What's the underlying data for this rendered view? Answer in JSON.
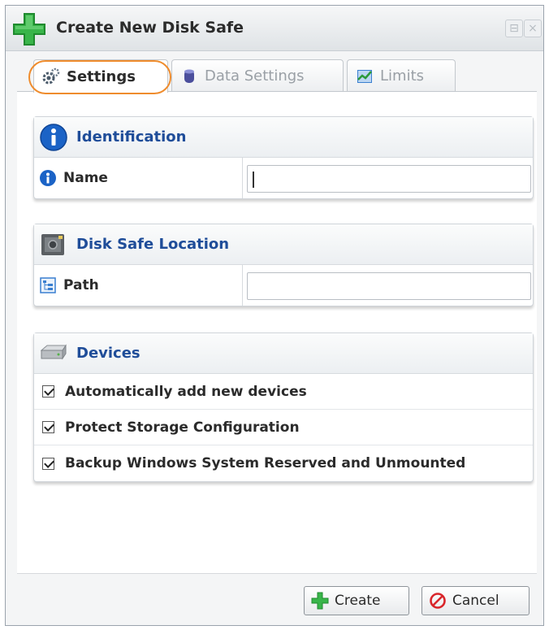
{
  "window": {
    "title": "Create New Disk Safe",
    "max_symbol": "⊟",
    "close_symbol": "×",
    "title_icon": "green-plus-icon"
  },
  "tabs": [
    {
      "label": "Settings",
      "icon": "gears-icon",
      "active": true
    },
    {
      "label": "Data Settings",
      "icon": "database-icon",
      "active": false
    },
    {
      "label": "Limits",
      "icon": "chart-icon",
      "active": false
    }
  ],
  "identification": {
    "title": "Identification",
    "icon": "info-icon",
    "name_label": "Name",
    "name_value": ""
  },
  "location": {
    "title": "Disk Safe Location",
    "icon": "safe-icon",
    "path_label": "Path",
    "path_value": ""
  },
  "devices": {
    "title": "Devices",
    "icon": "disk-drive-icon",
    "options": [
      {
        "label": "Automatically add new devices",
        "checked": true
      },
      {
        "label": "Protect Storage Configuration",
        "checked": true
      },
      {
        "label": "Backup Windows System Reserved and Unmounted",
        "checked": true
      }
    ]
  },
  "buttons": {
    "create_label": "Create",
    "cancel_label": "Cancel"
  },
  "colors": {
    "section_title": "#1f4d99",
    "highlight": "#ef8c2d",
    "plus_green": "#39b54a",
    "cancel_red": "#d9262b"
  }
}
